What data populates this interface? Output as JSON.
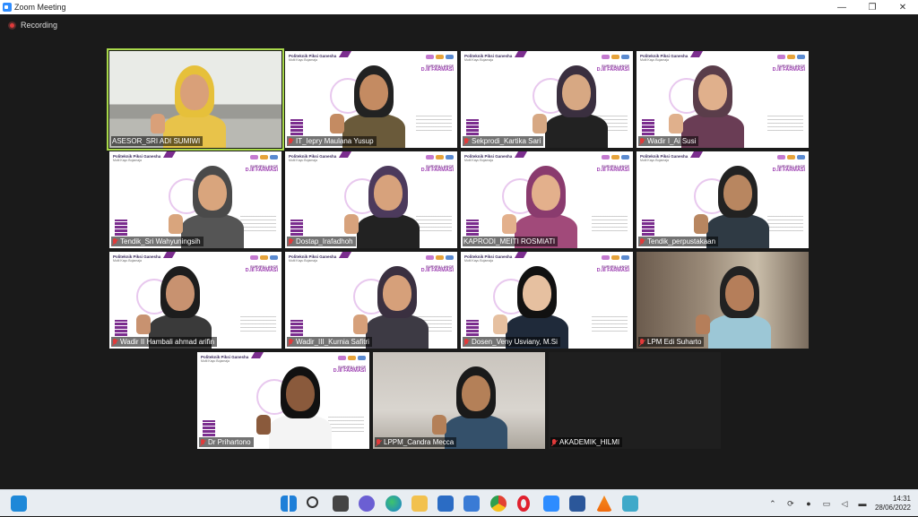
{
  "window": {
    "title": "Zoom Meeting",
    "controls": {
      "minimize": "—",
      "maximize": "❐",
      "close": "✕"
    }
  },
  "recording": {
    "label": "Recording"
  },
  "slide": {
    "school": "Politeknik Piksi Ganesha",
    "school_sub": "Multi Kayu Bojamaja",
    "heading": "SURVEILLANCE",
    "program": "D.III FARMASI"
  },
  "participants": [
    {
      "name": "ASESOR_SRI ADI SUMIWI",
      "muted": false,
      "active": true
    },
    {
      "name": "IT_Iepry Maulana Yusup",
      "muted": true
    },
    {
      "name": "Sekprodi_Kartika Sari",
      "muted": true
    },
    {
      "name": "Wadir I_Ai Susi",
      "muted": true
    },
    {
      "name": "Tendik_Sri Wahyuningsih",
      "muted": true
    },
    {
      "name": "Dostap_Irafadhoh",
      "muted": true
    },
    {
      "name": "KAPRODI_MEITI ROSMIATI",
      "muted": false
    },
    {
      "name": "Tendik_perpustakaan",
      "muted": true
    },
    {
      "name": "Wadir II Hambali ahmad arifin",
      "muted": true
    },
    {
      "name": "Wadir_III_Kurnia Safitri",
      "muted": true
    },
    {
      "name": "Dosen_Veny Usviany, M.Si",
      "muted": true
    },
    {
      "name": "LPM Edi Suharto",
      "muted": true
    },
    {
      "name": "Dr Prihartono",
      "muted": true
    },
    {
      "name": "LPPM_Candra Mecca",
      "muted": true
    },
    {
      "name": "AKADEMIK_HILMI",
      "muted": true
    }
  ],
  "taskbar": {
    "time": "14:31",
    "date": "28/06/2022"
  }
}
